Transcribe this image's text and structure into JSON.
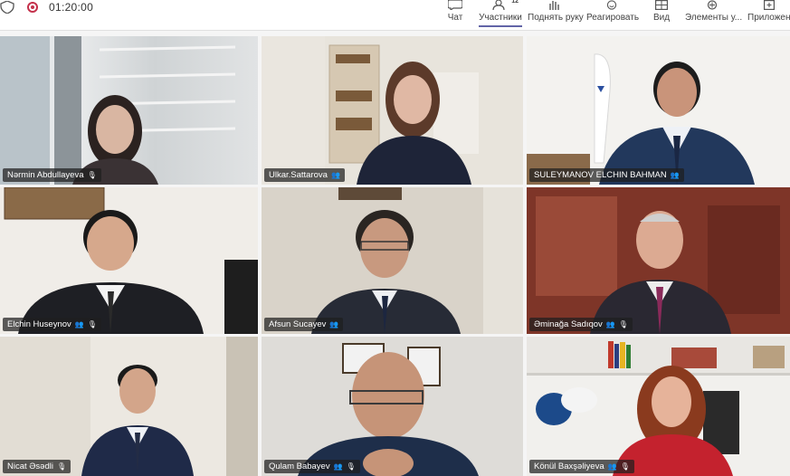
{
  "toolbar": {
    "timer": "01:20:00",
    "items": [
      {
        "id": "chat",
        "label": "Чат"
      },
      {
        "id": "participants",
        "label": "Участники",
        "badge": "12"
      },
      {
        "id": "raise-hand",
        "label": "Поднять руку"
      },
      {
        "id": "react",
        "label": "Реагировать"
      },
      {
        "id": "view",
        "label": "Вид"
      },
      {
        "id": "elements",
        "label": "Элементы у..."
      },
      {
        "id": "apps",
        "label": "Приложен"
      }
    ]
  },
  "participants": [
    {
      "name": "Nərmin Abdullayeva"
    },
    {
      "name": "Ulkar.Sattarova"
    },
    {
      "name": "SULEYMANOV ELCHIN BAHMAN"
    },
    {
      "name": "Elchin Huseynov"
    },
    {
      "name": "Afsun Sucayev"
    },
    {
      "name": "Əminağa Sadıqov"
    },
    {
      "name": "Nicat Əsədli"
    },
    {
      "name": "Qulam Babayev"
    },
    {
      "name": "Könül Baxşəliyeva"
    }
  ],
  "colors": {
    "accent": "#6264a7",
    "record": "#c4314b",
    "highlight": "#7f85f5"
  }
}
